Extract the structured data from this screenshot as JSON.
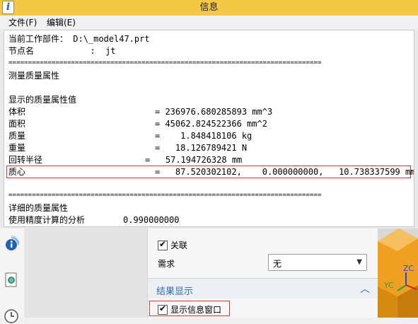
{
  "info_window": {
    "title": "信息",
    "title_icon": "i",
    "menu": {
      "file": "文件(F)",
      "edit": "编辑(E)"
    },
    "lines": {
      "part_label": "当前工作部件：",
      "part_value": " D:\\_model47.prt",
      "node_label": "节点名",
      "node_value": "           :  jt",
      "separator": "================================================================================",
      "section_title": "测量质量属性",
      "display_values_title": "显示的质量属性值",
      "volume_label": "体积",
      "volume_value": "= 236976.680285893 mm^3",
      "area_label": "面积",
      "area_value": "= 45062.824522366 mm^2",
      "mass_label": "质量",
      "mass_value": "=    1.848418106 kg",
      "weight_label": "重量",
      "weight_value": "=   18.126789421 N",
      "radius_label": "回转半径",
      "radius_value": "=   57.194726328 mm",
      "centroid_label": "质心",
      "centroid_value": "=   87.520302102,    0.000000000,   10.738337599 mm",
      "detail_title": "详细的质量属性",
      "accuracy_label": "使用精度计算的分析",
      "accuracy_value": "0.990000000"
    }
  },
  "dialog": {
    "associative_label": "关联",
    "associative_checked": true,
    "requirement_label": "需求",
    "requirement_value": "无",
    "result_section_title": "结果显示",
    "show_info_window_label": "显示信息窗口",
    "show_info_window_checked": true
  },
  "viewport": {
    "axis_zc": "ZC",
    "axis_yc": "YC"
  },
  "icons": {
    "info": "info-icon",
    "history": "history-icon",
    "clock": "clock-icon",
    "dropdown": "chevron-down-icon",
    "collapse": "chevron-up-icon"
  },
  "colors": {
    "title_bar": "#f3c842",
    "highlight_border": "#e03030",
    "section_title": "#2d6db0",
    "viewport_orange": "#f0a020"
  }
}
